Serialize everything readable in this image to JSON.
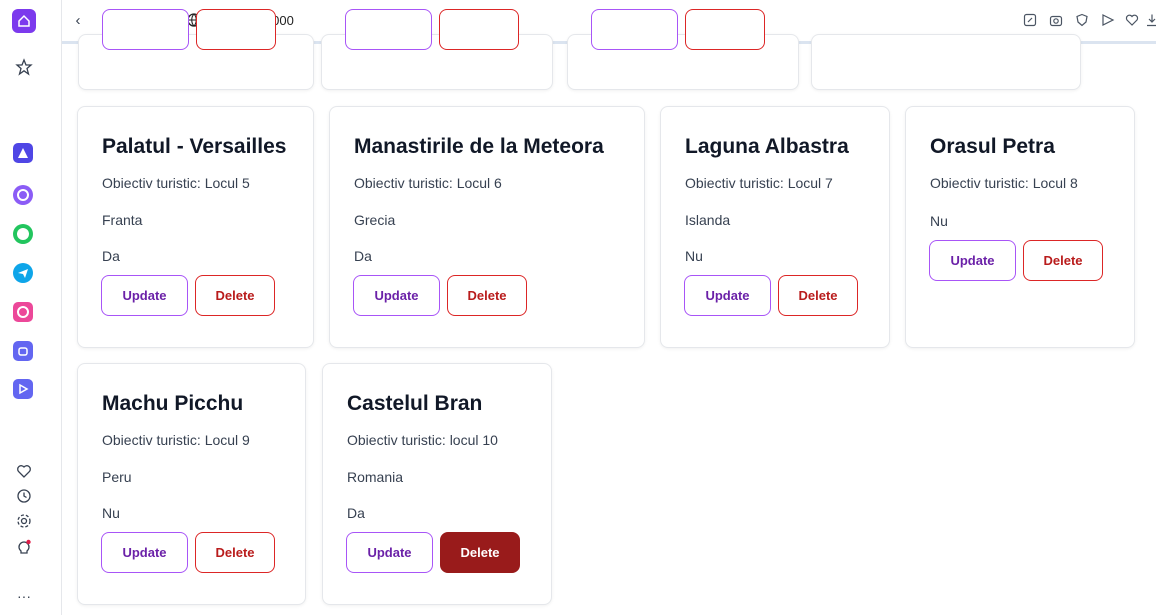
{
  "browser": {
    "url": "localhost:3000"
  },
  "cards": [
    {
      "title": "Palatul - Versailles",
      "subtitle": "Obiectiv turistic: Locul 5",
      "country": "Franta",
      "flag": "Da"
    },
    {
      "title": "Manastirile de la Meteora",
      "subtitle": "Obiectiv turistic: Locul 6",
      "country": "Grecia",
      "flag": "Da"
    },
    {
      "title": "Laguna Albastra",
      "subtitle": "Obiectiv turistic: Locul 7",
      "country": "Islanda",
      "flag": "Nu"
    },
    {
      "title": "Orasul Petra",
      "subtitle": "Obiectiv turistic: Locul 8",
      "country": "",
      "flag": "Nu"
    },
    {
      "title": "Machu Picchu",
      "subtitle": "Obiectiv turistic: Locul 9",
      "country": "Peru",
      "flag": "Nu"
    },
    {
      "title": "Castelul Bran",
      "subtitle": "Obiectiv turistic: locul 10",
      "country": "Romania",
      "flag": "Da"
    }
  ],
  "buttons": {
    "update": "Update",
    "delete": "Delete"
  },
  "sidebar": {
    "apps": [
      "app-icon",
      "messenger-icon",
      "whatsapp-icon",
      "telegram-icon",
      "instagram-icon",
      "music-icon",
      "player-icon"
    ]
  },
  "colors": {
    "accent": "#7c3aed",
    "update_border": "#a855f7",
    "delete_border": "#dc2626",
    "delete_active": "#991b1b"
  }
}
